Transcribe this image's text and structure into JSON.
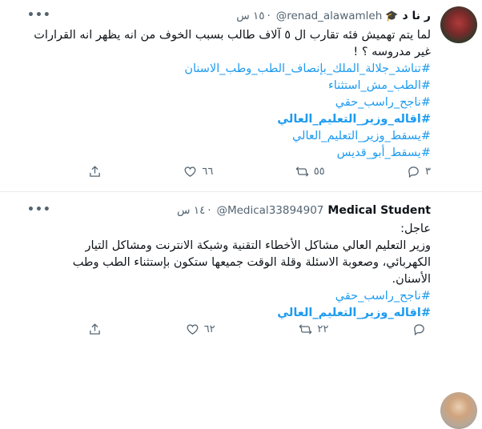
{
  "tweets": [
    {
      "author_name": "ر نا د",
      "handle": "@renad_alawamleh",
      "time": "١٥ س",
      "more_icon": "•••",
      "text_lines": [
        "لما يتم تهميش فئه تقارب ال ٥ آلاف طالب بسبب الخوف من انه يظهر انه القرارات",
        "غير مدروسه ؟ !"
      ],
      "hashtags": [
        "#تناشد_جلالة_الملك_بإنصاف_الطب_وطب_الاسنان",
        "#الطب_مش_استثناء",
        "#ناجح_راسب_حقي",
        "#اقاله_وزير_التعليم_العالي",
        "#يسقط_وزير_التعليم_العالي",
        "#يسقط_أبو_قديس"
      ],
      "bold_hashtag_index": 3,
      "reply_count": "٣",
      "retweet_count": "٥٥",
      "like_count": "٦٦"
    },
    {
      "author_name": "Medical Student",
      "handle": "@Medical33894907",
      "time": "١٤ س",
      "more_icon": "•••",
      "text_lines": [
        "عاجل:",
        "وزير التعليم العالي مشاكل الأخطاء التقنية وشبكة الانترنت ومشاكل التيار",
        "الكهربائي، وصعوبة الاسئلة وقلة الوقت جميعها ستكون بإستثناء الطب وطب",
        "الأسنان."
      ],
      "hashtags": [
        "#ناجح_راسب_حقي",
        "#اقاله_وزير_التعليم_العالي"
      ],
      "bold_hashtag_index": 1,
      "reply_count": "",
      "retweet_count": "٢٢",
      "like_count": "٦٢"
    }
  ]
}
